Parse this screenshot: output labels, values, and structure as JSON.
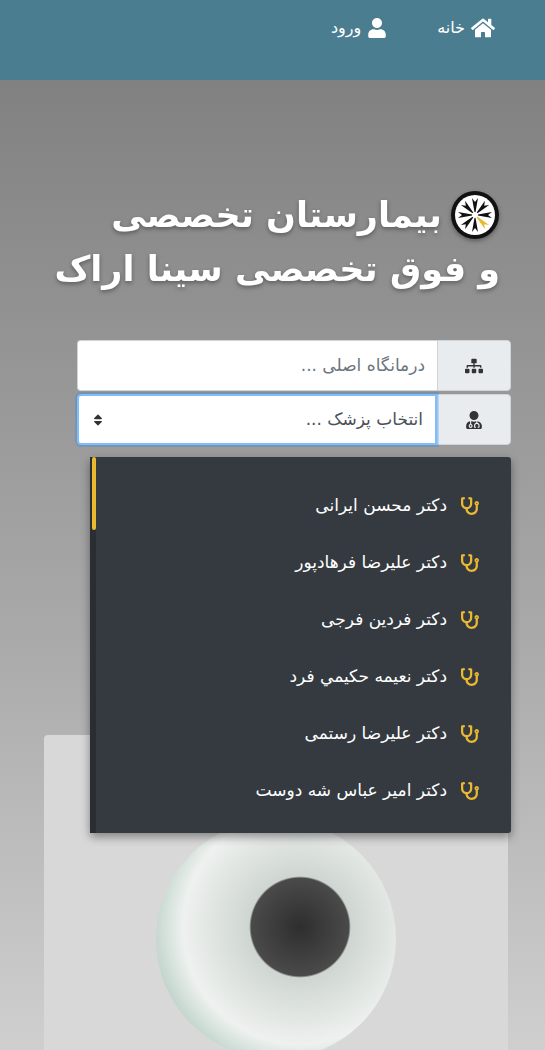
{
  "navbar": {
    "items": [
      {
        "label": "خانه",
        "icon": "home"
      },
      {
        "label": "ورود",
        "icon": "user"
      }
    ]
  },
  "header": {
    "title_lines": [
      "بیمارستان تخصصی",
      "و فوق تخصصی سینا اراک"
    ]
  },
  "form": {
    "clinic_field": {
      "placeholder": "درمانگاه اصلی ..."
    },
    "doctor_select": {
      "placeholder": "انتخاب پزشک ...",
      "focused": true,
      "open": true
    }
  },
  "doctor_dropdown": {
    "items": [
      {
        "label": "دکتر محسن ایرانی",
        "selected": false
      },
      {
        "label": "دکتر علیرضا فرهادپور",
        "selected": false
      },
      {
        "label": "دکتر فردین فرجی",
        "selected": false
      },
      {
        "label": "دکتر نعیمه حکيمي فرد",
        "selected": false
      },
      {
        "label": "دکتر علیرضا رستمی",
        "selected": false
      },
      {
        "label": "دکتر امیر عباس شه دوست",
        "selected": false
      }
    ]
  }
}
